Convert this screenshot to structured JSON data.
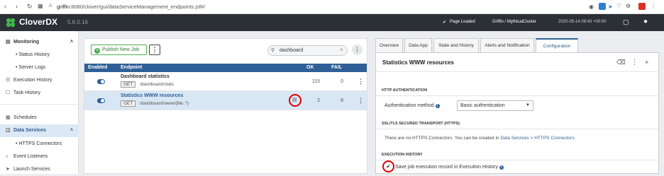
{
  "browser": {
    "url_host": "griffin",
    "url_rest": ":8080/clover/gui/dataServiceManagement_endpoints.jsf#/"
  },
  "header": {
    "brand": "CloverDX",
    "version": "5.6.0.16",
    "page_status": "Page Loaded",
    "user": "Griffin / MythicalCluster",
    "timestamp": "2020-05-14 08:43 +00:00"
  },
  "sidebar": {
    "items": [
      {
        "label": "Monitoring",
        "type": "section"
      },
      {
        "label": "Status History",
        "type": "sub"
      },
      {
        "label": "Server Logs",
        "type": "sub"
      },
      {
        "label": "Execution History",
        "type": "item"
      },
      {
        "label": "Task History",
        "type": "item"
      },
      {
        "label": "Schedules",
        "type": "item"
      },
      {
        "label": "Data Services",
        "type": "active"
      },
      {
        "label": "HTTPS Connectors",
        "type": "sub"
      },
      {
        "label": "Event Listeners",
        "type": "item"
      },
      {
        "label": "Launch Services",
        "type": "item"
      }
    ]
  },
  "toolbar": {
    "publish_label": "Publish New Job",
    "search_value": "dashboard"
  },
  "table": {
    "columns": {
      "enabled": "Enabled",
      "endpoint": "Endpoint",
      "ok": "OK",
      "fail": "FAIL"
    },
    "rows": [
      {
        "name": "Dashboard statistics",
        "method": "GET",
        "path": "/dashboard/stats",
        "ok": "115",
        "fail": "0"
      },
      {
        "name": "Statistics WWW resources",
        "method": "GET",
        "path": "/dashboard/www/{file:.*}",
        "ok": "2",
        "fail": "8"
      }
    ]
  },
  "details": {
    "tabs": [
      "Overview",
      "Data App",
      "State and History",
      "Alerts and Notification",
      "Configuration"
    ],
    "title": "Statistics WWW resources",
    "http_auth_heading": "HTTP AUTHENTICATION",
    "auth_method_label": "Authentication method",
    "auth_method_value": "Basic authentication",
    "ssl_heading": "SSL/TLS SECURED TRANSPORT (HTTPS)",
    "ssl_note": "There are no HTTPS Connectors. You can be created in",
    "ssl_link": "Data Services > HTTPS Connectors",
    "exec_heading": "EXECUTION HISTORY",
    "save_history_label": "Save job execution record in Execution History"
  },
  "colors": {
    "accent": "#2e5f97",
    "header_bg": "#2b2f36",
    "highlight_ring": "#e00000",
    "publish_green": "#4caf50"
  }
}
